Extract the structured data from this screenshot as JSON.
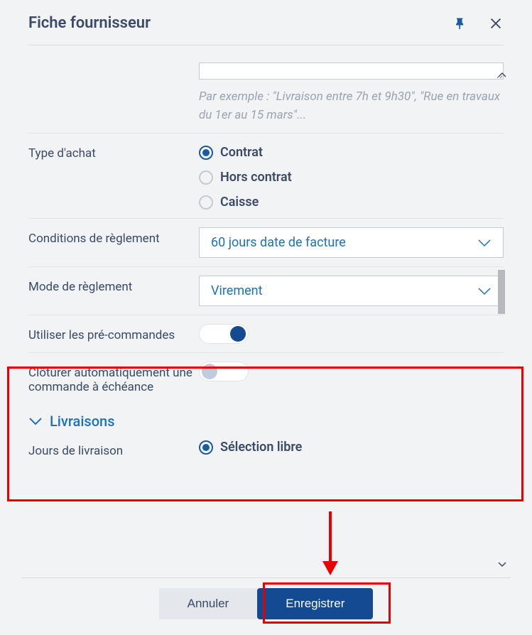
{
  "header": {
    "title": "Fiche fournisseur"
  },
  "form": {
    "example_help": "Par exemple : \"Livraison entre 7h et 9h30\", \"Rue en travaux du 1er au 15 mars\"...",
    "purchase_type_label": "Type d'achat",
    "purchase_types": [
      {
        "label": "Contrat",
        "checked": true
      },
      {
        "label": "Hors contrat",
        "checked": false
      },
      {
        "label": "Caisse",
        "checked": false
      }
    ],
    "payment_terms_label": "Conditions de règlement",
    "payment_terms_value": "60 jours date de facture",
    "payment_mode_label": "Mode de règlement",
    "payment_mode_value": "Virement",
    "preorders_label": "Utiliser les pré-commandes",
    "preorders_on": true,
    "autoclose_label": "Clôturer automatiquement une commande à échéance",
    "autoclose_on": false,
    "deliveries_section": "Livraisons",
    "delivery_days_label": "Jours de livraison",
    "delivery_days_value": "Sélection libre"
  },
  "footer": {
    "cancel": "Annuler",
    "save": "Enregistrer"
  }
}
